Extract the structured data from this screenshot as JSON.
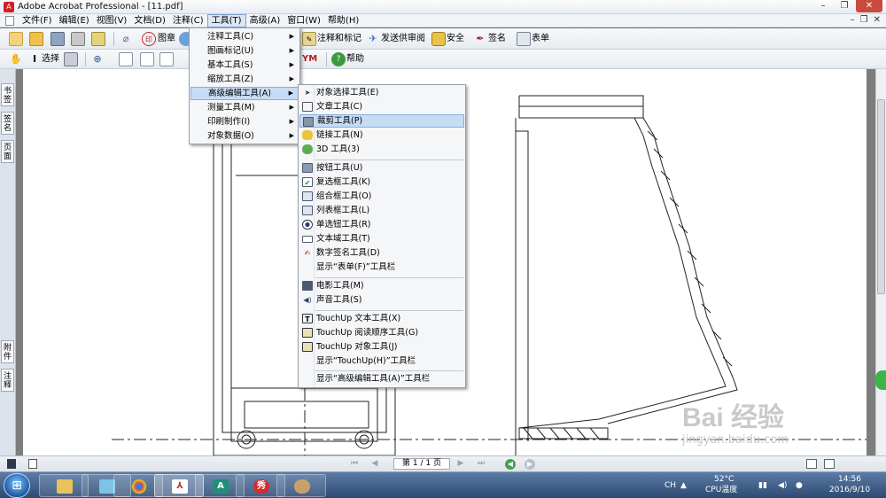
{
  "window": {
    "title": "Adobe Acrobat Professional - [11.pdf]",
    "controls": [
      "–",
      "❐",
      "✕"
    ],
    "mdi_controls": [
      "–",
      "❐",
      "✕"
    ]
  },
  "menubar": {
    "items": [
      "文件(F)",
      "编辑(E)",
      "视图(V)",
      "文档(D)",
      "注释(C)",
      "工具(T)",
      "高级(A)",
      "窗口(W)",
      "帮助(H)"
    ]
  },
  "toolbar1": {
    "stamp_label": "图章",
    "comment_label": "注释和标记",
    "review_label": "发送供审阅",
    "security_label": "安全",
    "sign_label": "签名",
    "forms_label": "表单"
  },
  "toolbar2": {
    "select_label": "选择",
    "typewriter_label": "YM",
    "help_label": "帮助"
  },
  "leftnav": {
    "tabs": [
      "书签",
      "签名",
      "页面",
      "附件",
      "注释"
    ]
  },
  "tools_menu": {
    "items": [
      {
        "label": "注释工具(C)",
        "has_submenu": true
      },
      {
        "label": "图画标记(U)",
        "has_submenu": true
      },
      {
        "label": "基本工具(S)",
        "has_submenu": true
      },
      {
        "label": "缩放工具(Z)",
        "has_submenu": true
      },
      {
        "label": "高级编辑工具(A)",
        "has_submenu": true
      },
      {
        "label": "测量工具(M)",
        "has_submenu": true
      },
      {
        "label": "印刷制作(I)",
        "has_submenu": true
      },
      {
        "label": "对象数据(O)",
        "has_submenu": true
      }
    ],
    "highlighted_index": 4
  },
  "advanced_submenu": {
    "items": [
      {
        "label": "对象选择工具(E)",
        "icon": "pointer-icon"
      },
      {
        "label": "文章工具(C)",
        "icon": "article-icon"
      },
      {
        "label": "裁剪工具(P)",
        "icon": "crop-icon"
      },
      {
        "label": "链接工具(N)",
        "icon": "link-icon"
      },
      {
        "label": "3D 工具(3)",
        "icon": "3d-icon"
      },
      {
        "label": "按钮工具(U)",
        "icon": "button-tool-icon"
      },
      {
        "label": "复选框工具(K)",
        "icon": "checkbox-icon"
      },
      {
        "label": "组合框工具(O)",
        "icon": "combobox-icon"
      },
      {
        "label": "列表框工具(L)",
        "icon": "listbox-icon"
      },
      {
        "label": "单选钮工具(R)",
        "icon": "radio-icon"
      },
      {
        "label": "文本域工具(T)",
        "icon": "textfield-icon"
      },
      {
        "label": "数字签名工具(D)",
        "icon": "signature-icon"
      },
      {
        "label": "显示“表单(F)”工具栏",
        "icon": ""
      },
      {
        "label": "电影工具(M)",
        "icon": "movie-icon"
      },
      {
        "label": "声音工具(S)",
        "icon": "sound-icon"
      },
      {
        "label": "TouchUp 文本工具(X)",
        "icon": "touchup-text-icon"
      },
      {
        "label": "TouchUp 阅读顺序工具(G)",
        "icon": "touchup-order-icon"
      },
      {
        "label": "TouchUp 对象工具(J)",
        "icon": "touchup-object-icon"
      },
      {
        "label": "显示“TouchUp(H)”工具栏",
        "icon": ""
      },
      {
        "label": "显示“高级编辑工具(A)”工具栏",
        "icon": ""
      }
    ],
    "highlighted_index": 2
  },
  "statusbar": {
    "page_indicator": "第 1 / 1 页"
  },
  "taskbar": {
    "apps": [
      "file-explorer-icon",
      "desktop-icon",
      "chrome-icon",
      "acrobat-icon",
      "autocad-icon",
      "360-icon",
      "paint-icon"
    ],
    "input_lang": "CH",
    "temp": "52°C",
    "temp_label": "CPU温度",
    "time": "14:56",
    "date": "2016/9/10"
  },
  "watermark": {
    "brand": "Bai 经验",
    "url": "jingyan.baidu.com"
  },
  "colors": {
    "menu_highlight": "#c6dcf5",
    "taskbar": "#2d4a72",
    "accent_red": "#d02020"
  }
}
